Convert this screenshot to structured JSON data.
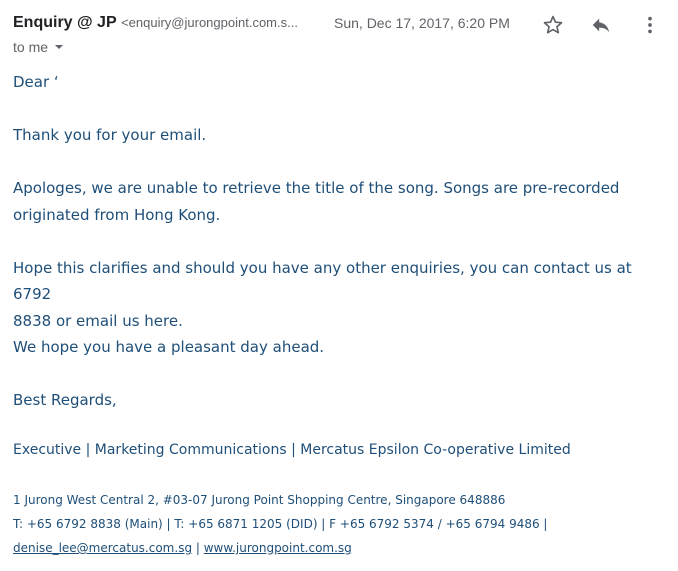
{
  "header": {
    "sender_name": "Enquiry @ JP",
    "sender_email": "<enquiry@jurongpoint.com.s...",
    "date": "Sun, Dec 17, 2017, 6:20 PM",
    "recipient_label": "to me",
    "icons": {
      "star": "star-icon",
      "reply": "reply-icon",
      "more": "more-vert-icon",
      "recipient_dropdown": "chevron-down-icon"
    }
  },
  "body": {
    "greeting": "Dear ‘",
    "p1": "Thank you for your email.",
    "p2_line1": "Apologes, we are unable to retrieve the title of the song. Songs are pre-recorded",
    "p2_line2": "originated from Hong Kong.",
    "p3_line1": "Hope this clarifies and should you have any other enquiries, you can contact us at 6792",
    "p3_line2": "8838 or email us here.",
    "p3_line3": "We hope you have a pleasant day ahead.",
    "closing": "Best Regards,"
  },
  "signature": {
    "title": "Executive | Marketing Communications | Mercatus Epsilon Co-operative Limited",
    "address": "1 Jurong West Central 2, #03-07 Jurong Point Shopping Centre, Singapore 648886",
    "phones": "T: +65 6792 8838 (Main) | T: +65 6871 1205 (DID) | F +65 6792 5374 / +65 6794 9486 |",
    "email_link": "denise_lee@mercatus.com.sg",
    "separator": " | ",
    "website_link": "www.jurongpoint.com.sg"
  },
  "colors": {
    "body_text": "#1f4f78",
    "meta_text": "#5f6368",
    "sender_text": "#202124"
  }
}
